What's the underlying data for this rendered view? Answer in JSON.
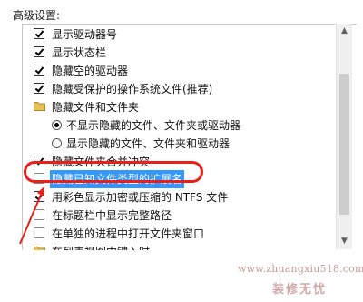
{
  "heading": "高级设置:",
  "items": [
    {
      "type": "checkbox",
      "checked": true,
      "label": "显示驱动器号"
    },
    {
      "type": "checkbox",
      "checked": true,
      "label": "显示状态栏"
    },
    {
      "type": "checkbox",
      "checked": true,
      "label": "隐藏空的驱动器"
    },
    {
      "type": "checkbox",
      "checked": true,
      "label": "隐藏受保护的操作系统文件(推荐)"
    },
    {
      "type": "folder",
      "label": "隐藏文件和文件夹"
    },
    {
      "type": "radio",
      "selected": true,
      "label": "不显示隐藏的文件、文件夹或驱动器"
    },
    {
      "type": "radio",
      "selected": false,
      "label": "显示隐藏的文件、文件夹和驱动器"
    },
    {
      "type": "checkbox",
      "checked": true,
      "label": "隐藏文件夹合并冲突"
    },
    {
      "type": "checkbox",
      "checked": false,
      "label": "隐藏已知文件类型的扩展名",
      "highlighted": true
    },
    {
      "type": "checkbox",
      "checked": true,
      "label": "用彩色显示加密或压缩的 NTFS 文件"
    },
    {
      "type": "checkbox",
      "checked": false,
      "label": "在标题栏中显示完整路径"
    },
    {
      "type": "checkbox",
      "checked": false,
      "label": "在单独的进程中打开文件夹窗口"
    },
    {
      "type": "folder",
      "label": "在列表视图中键入时"
    }
  ],
  "watermark": {
    "url": "www.zhuangxiu518.com",
    "name": "装修无忧"
  },
  "colors": {
    "highlight": "#3399ff",
    "annotation": "#e8201a"
  }
}
